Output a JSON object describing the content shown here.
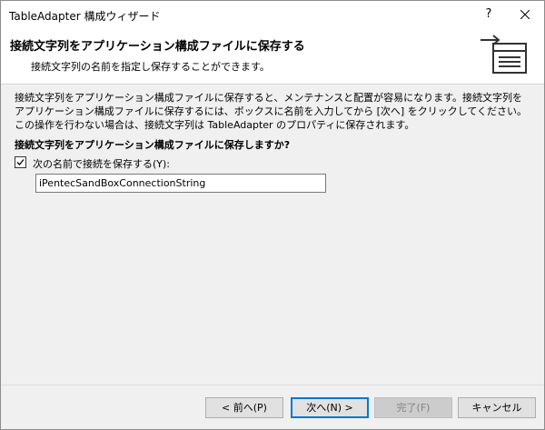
{
  "window": {
    "title": "TableAdapter 構成ウィザード",
    "help_label": "?"
  },
  "header": {
    "title": "接続文字列をアプリケーション構成ファイルに保存する",
    "subtitle": "接続文字列の名前を指定し保存することができます。"
  },
  "body": {
    "description": "接続文字列をアプリケーション構成ファイルに保存すると、メンテナンスと配置が容易になります。接続文字列をアプリケーション構成ファイルに保存するには、ボックスに名前を入力してから [次へ] をクリックしてください。この操作を行わない場合は、接続文字列は TableAdapter のプロパティに保存されます。",
    "question": "接続文字列をアプリケーション構成ファイルに保存しますか?",
    "checkbox_label": "次の名前で接続を保存する(Y):",
    "checkbox_checked": true,
    "connection_name": "iPentecSandBoxConnectionString"
  },
  "buttons": {
    "prev": "< 前へ(P)",
    "next": "次へ(N) >",
    "finish": "完了(F)",
    "cancel": "キャンセル"
  },
  "colors": {
    "accent": "#0078d7",
    "icon": "#333333"
  },
  "icons": {
    "header": "save-to-config-icon",
    "close": "close-icon",
    "check": "checkmark-icon"
  }
}
